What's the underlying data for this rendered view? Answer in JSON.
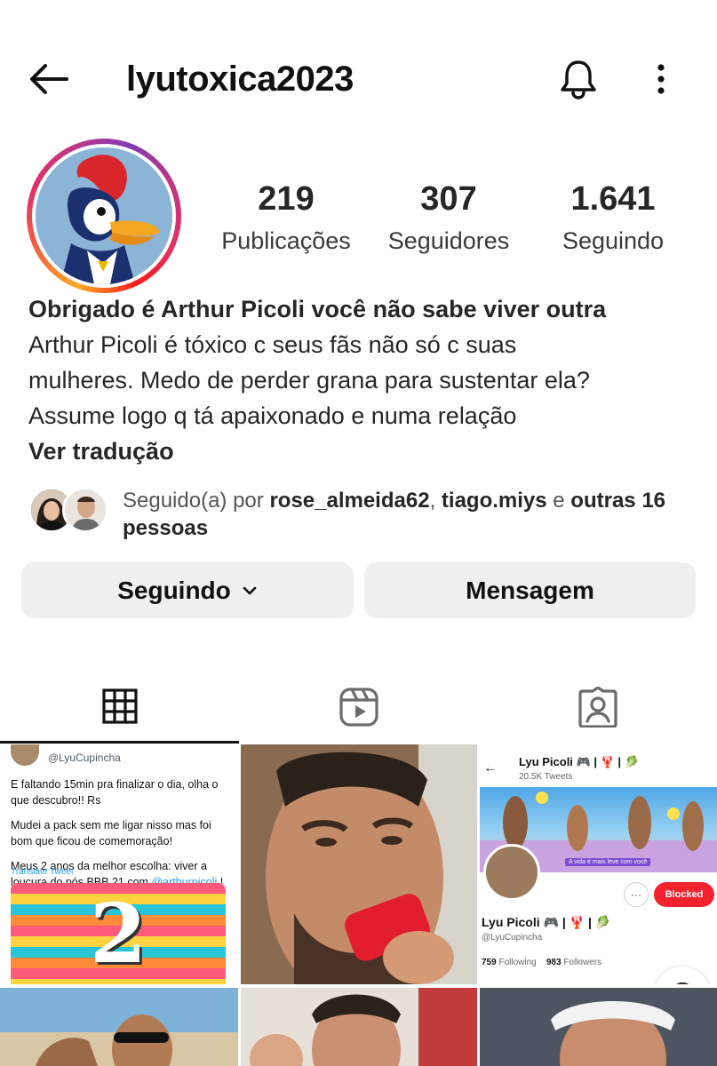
{
  "header": {
    "username": "lyutoxica2023",
    "back_icon": "arrow-left-icon",
    "bell_icon": "bell-icon",
    "more_icon": "more-vertical-icon"
  },
  "stats": {
    "posts": {
      "value": "219",
      "label": "Publicações"
    },
    "followers": {
      "value": "307",
      "label": "Seguidores"
    },
    "following": {
      "value": "1.641",
      "label": "Seguindo"
    }
  },
  "bio": {
    "title": "Obrigado é Arthur Picoli você não sabe viver outra",
    "lines": [
      "Arthur Picoli é tóxico c seus fãs não só c suas",
      "mulheres.  Medo de perder grana para sustentar ela?",
      "Assume logo q tá apaixonado e numa relação"
    ],
    "translate_link": "Ver tradução"
  },
  "followed_by": {
    "prefix": "Seguido(a) por ",
    "user1": "rose_almeida62",
    "sep1": ", ",
    "user2": "tiago.miys",
    "sep2": " e ",
    "others": "outras 16 pessoas"
  },
  "actions": {
    "following_label": "Seguindo",
    "message_label": "Mensagem"
  },
  "tabs": [
    {
      "icon": "grid-icon",
      "active": true
    },
    {
      "icon": "reels-icon",
      "active": false
    },
    {
      "icon": "tagged-person-icon",
      "active": false
    }
  ],
  "posts": {
    "tweet": {
      "name": "Lyu Picoli 🎮 | 🦞 | 🥬",
      "handle": "@LyuCupincha",
      "p1": "E faltando 15min pra finalizar o dia, olha o que descubro!! Rs",
      "p2": "Mudei a pack sem me ligar nisso mas foi bom que ficou de comemoração!",
      "p3_start": "Meus 2 anos da melhor escolha: viver a loucura do pós BBB 21 com ",
      "p3_mention": "@arthurpicoli",
      "p3_end": " !",
      "translate": "Translate Tweet",
      "image_number": "2"
    },
    "profile": {
      "name": "Lyu Picoli 🎮 | 🦞 | 🥬",
      "tweets": "20.5K Tweets",
      "banner_caption": "A vida é mais leve com você",
      "blocked": "Blocked",
      "more": "···",
      "handle": "@LyuCupincha",
      "following_count": "759",
      "following_label": "Following",
      "followers_count": "983",
      "followers_label": "Followers",
      "reaction": "😍"
    }
  }
}
